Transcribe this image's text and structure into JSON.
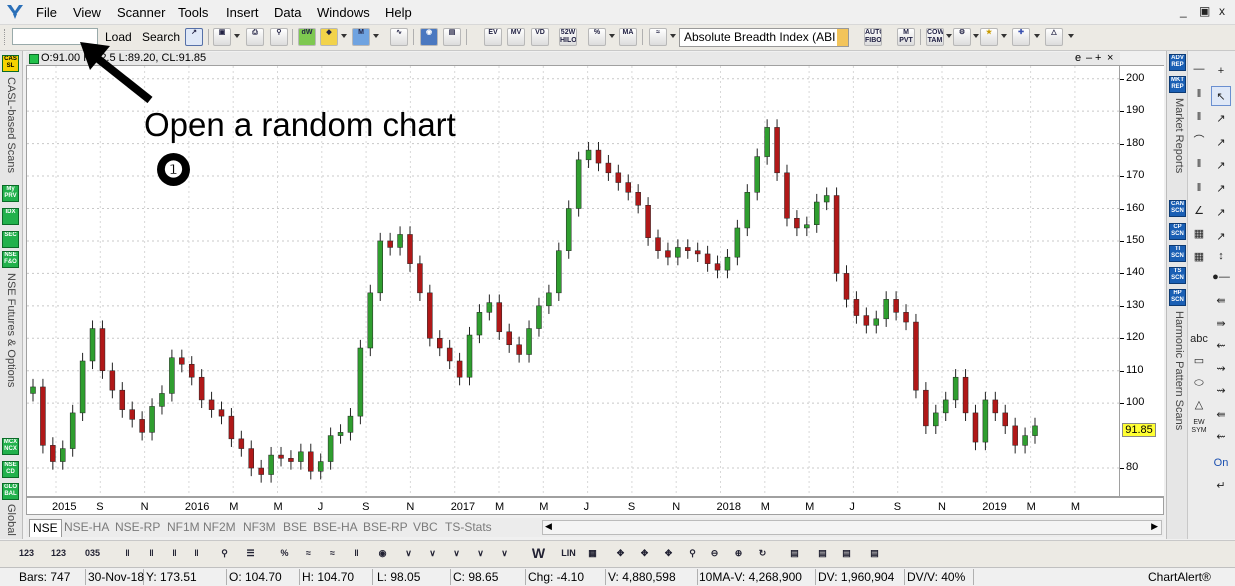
{
  "menubar": {
    "items": [
      "File",
      "View",
      "Scanner",
      "Tools",
      "Insert",
      "Data",
      "Windows",
      "Help"
    ],
    "window_controls": [
      "_",
      "▣",
      "x"
    ]
  },
  "toolbar": {
    "symbol_value": "",
    "load_label": "Load",
    "search_label": "Search",
    "indicator_selected": "Absolute Breadth Index (ABI"
  },
  "leftpanel": {
    "badges": [
      "CAS\nSL",
      "My\nPRV",
      "IDX",
      "SEC",
      "NSE\nF&O",
      "MCX\nNCX",
      "NSE\nCD",
      "GLO\nBAL"
    ],
    "labels": [
      "CASL-based Scans",
      "NSE Futures & Options",
      "Global"
    ]
  },
  "chart": {
    "header": "O:91.00 H:92.5 L:89.20, CL:91.85",
    "header_controls": [
      "e",
      "–",
      "+",
      "×"
    ],
    "current_price": "91.85"
  },
  "chart_data": {
    "type": "candlestick",
    "title": "",
    "price_ticks": [
      200,
      190,
      180,
      170,
      160,
      150,
      140,
      130,
      120,
      110,
      100,
      80
    ],
    "date_ticks": [
      "2015",
      "S",
      "N",
      "2016",
      "M",
      "M",
      "J",
      "S",
      "N",
      "2017",
      "M",
      "M",
      "J",
      "S",
      "N",
      "2018",
      "M",
      "M",
      "J",
      "S",
      "N",
      "2019",
      "M",
      "M"
    ],
    "ylim": [
      72,
      203
    ],
    "closes": [
      105,
      87,
      82,
      86,
      97,
      113,
      123,
      110,
      104,
      98,
      95,
      91,
      99,
      103,
      114,
      112,
      108,
      101,
      98,
      96,
      89,
      86,
      80,
      78,
      84,
      83,
      82,
      85,
      79,
      82,
      90,
      91,
      96,
      117,
      134,
      150,
      148,
      152,
      143,
      134,
      120,
      117,
      113,
      108,
      121,
      128,
      131,
      122,
      118,
      115,
      123,
      130,
      134,
      147,
      160,
      175,
      178,
      174,
      171,
      168,
      165,
      161,
      151,
      147,
      145,
      148,
      147,
      146,
      143,
      141,
      145,
      154,
      165,
      176,
      185,
      171,
      157,
      154,
      155,
      162,
      164,
      140,
      132,
      127,
      124,
      126,
      132,
      128,
      125,
      104,
      93,
      97,
      101,
      108,
      97,
      88,
      101,
      97,
      93,
      87,
      90,
      93
    ]
  },
  "reportpanel": {
    "badges": [
      "ADV\nREP",
      "MKT\nREP",
      "CAN\nSCN",
      "CP\nSCN",
      "TI\nSCN",
      "TS\nSCN",
      "HP\nSCN"
    ],
    "labels": [
      "Market Reports",
      "Harmonic Pattern Scans"
    ]
  },
  "drawpanel": {
    "text_tool": "abc",
    "ew_label": "EW\nSYM",
    "on_label": "On"
  },
  "tabs": [
    "NSE",
    "NSE-HA",
    "NSE-RP",
    "NF1M",
    "NF2M",
    "NF3M",
    "BSE",
    "BSE-HA",
    "BSE-RP",
    "VBC",
    "TS-Stats"
  ],
  "statusbar": {
    "bars": "Bars: 747",
    "date": "30-Nov-18",
    "y": "Y: 173.51",
    "open": "O: 104.70",
    "high": "H: 104.70",
    "low": "L: 98.05",
    "close": "C: 98.65",
    "change": "Chg: -4.10",
    "volume": "V: 4,880,598",
    "ma_volume": "10MA-V: 4,268,900",
    "dv": "DV: 1,960,904",
    "dv_v": "DV/V: 40%",
    "brand": "ChartAlert®"
  },
  "annotation": {
    "text": "Open a random chart",
    "number": "❶"
  }
}
